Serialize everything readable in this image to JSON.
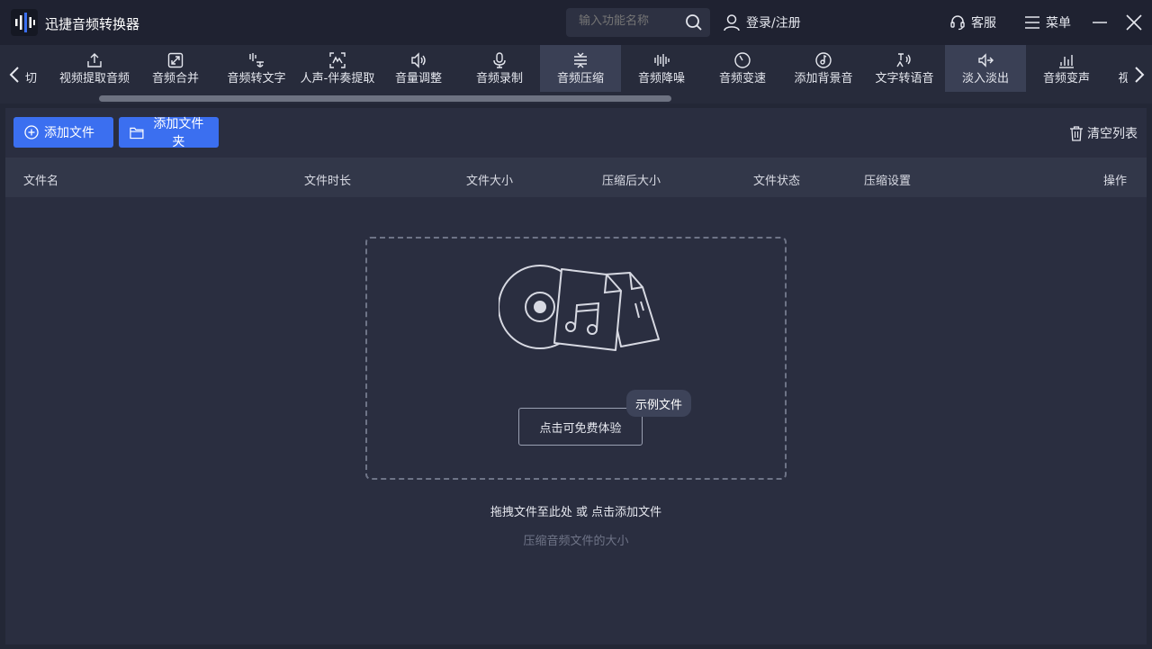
{
  "app": {
    "title": "迅捷音频转换器"
  },
  "header": {
    "search_placeholder": "输入功能名称",
    "login_label": "登录/注册",
    "service_label": "客服",
    "menu_label": "菜单"
  },
  "tools": [
    {
      "label": "音频剪切",
      "icon": "scissors-icon"
    },
    {
      "label": "视频提取音频",
      "icon": "upload-icon"
    },
    {
      "label": "音频合并",
      "icon": "merge-icon"
    },
    {
      "label": "音频转文字",
      "icon": "audio-to-text-icon"
    },
    {
      "label": "人声-伴奏提取",
      "icon": "vocal-extract-icon"
    },
    {
      "label": "音量调整",
      "icon": "volume-icon"
    },
    {
      "label": "音频录制",
      "icon": "microphone-icon"
    },
    {
      "label": "音频压缩",
      "icon": "compress-icon",
      "active": true
    },
    {
      "label": "音频降噪",
      "icon": "denoise-icon"
    },
    {
      "label": "音频变速",
      "icon": "speed-icon"
    },
    {
      "label": "添加背景音",
      "icon": "background-music-icon"
    },
    {
      "label": "文字转语音",
      "icon": "text-to-speech-icon"
    },
    {
      "label": "淡入淡出",
      "icon": "fade-icon",
      "hovered": true
    },
    {
      "label": "音频变声",
      "icon": "voice-change-icon"
    },
    {
      "label": "视频转音频",
      "icon": "video-icon"
    }
  ],
  "actions": {
    "add_file": "添加文件",
    "add_folder": "添加文件夹",
    "clear_list": "清空列表"
  },
  "table": {
    "columns": [
      "文件名",
      "文件时长",
      "文件大小",
      "压缩后大小",
      "文件状态",
      "压缩设置",
      "操作"
    ]
  },
  "dropzone": {
    "try_button": "点击可免费体验",
    "sample_tag": "示例文件",
    "hint": "拖拽文件至此处 或 点击添加文件",
    "subhint": "压缩音频文件的大小"
  },
  "colors": {
    "accent": "#3b6ff0",
    "background": "#232736",
    "panel": "#2a2e40"
  }
}
